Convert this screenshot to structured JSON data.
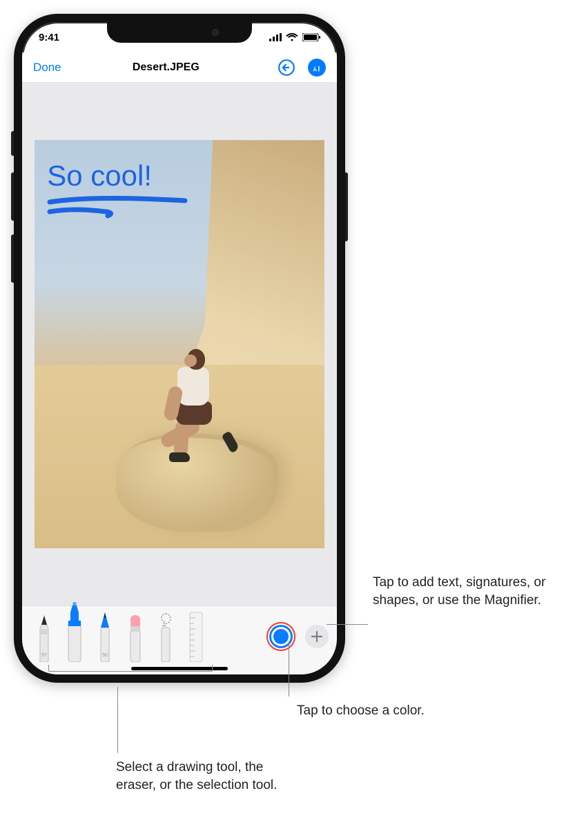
{
  "status": {
    "time": "9:41"
  },
  "nav": {
    "done": "Done",
    "title": "Desert.JPEG"
  },
  "annotation": {
    "text": "So cool!"
  },
  "tools": {
    "pen_label": "97",
    "pencil_label": "50"
  },
  "callouts": {
    "add": "Tap to add text, signatures, or shapes, or use the Magnifier.",
    "color": "Tap to choose a color.",
    "tools": "Select a drawing tool, the eraser, or the selection tool."
  }
}
